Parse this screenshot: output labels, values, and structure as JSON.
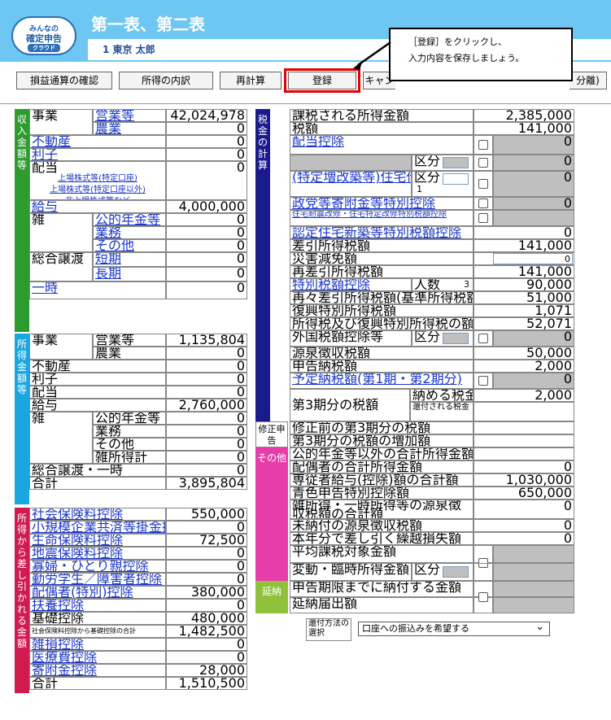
{
  "header": {
    "logo_top": "みんなの",
    "logo_mid": "確定申告",
    "logo_bot": "クラウド",
    "title": "第一表、第二表",
    "user": "1 東京 太郎"
  },
  "toolbar": {
    "btns": [
      "損益通算の確認",
      "所得の内訳",
      "再計算",
      "登録",
      "キャン",
      "分離)"
    ]
  },
  "callout": {
    "line1": "［登録］をクリックし、",
    "line2": "入力内容を保存しましょう。"
  },
  "colors": {
    "income": "#2e9b2e",
    "shotoku": "#1aa7e0",
    "kojo": "#d11a4d",
    "zeikin": "#1a1a8c",
    "sonota": "#e83caa",
    "enno": "#8fc23a"
  },
  "left": {
    "sec1": "収入金額等",
    "sec2": "所得金額等",
    "sec3": "所得から差し引かれる金額",
    "r": [
      {
        "a": "事業",
        "b": "営業等",
        "v": "42,024,978"
      },
      {
        "b": "農業",
        "v": "0"
      },
      {
        "a": "不動産",
        "v": "0"
      },
      {
        "a": "利子",
        "v": "0"
      },
      {
        "a": "配当",
        "sub1": "上場株式等(特定口座)",
        "sub2": "上場株式等(特定口座以外)",
        "sub3": "非上場株式等など",
        "v": "0"
      },
      {
        "a": "給与",
        "v": "4,000,000"
      },
      {
        "a": "雑",
        "b": "公的年金等",
        "v": "0"
      },
      {
        "b": "業務",
        "v": "0"
      },
      {
        "b": "その他",
        "v": "0"
      },
      {
        "a": "総合譲渡",
        "b": "短期",
        "v": "0"
      },
      {
        "b": "長期",
        "v": "0"
      },
      {
        "a": "一時",
        "v": "0"
      }
    ],
    "s": [
      {
        "a": "事業",
        "b": "営業等",
        "v": "1,135,804"
      },
      {
        "b": "農業",
        "v": "0"
      },
      {
        "a": "不動産",
        "v": "0"
      },
      {
        "a": "利子",
        "v": "0"
      },
      {
        "a": "配当",
        "v": "0"
      },
      {
        "a": "給与",
        "v": "2,760,000"
      },
      {
        "a": "雑",
        "b": "公的年金等",
        "v": "0"
      },
      {
        "b": "業務",
        "v": "0"
      },
      {
        "b": "その他",
        "v": "0"
      },
      {
        "b": "雑所得計",
        "v": "0"
      },
      {
        "a": "総合譲渡・一時",
        "v": "0"
      },
      {
        "a": "合計",
        "v": "3,895,804"
      }
    ],
    "k": [
      {
        "a": "社会保険料控除",
        "v": "550,000"
      },
      {
        "a": "小規模企業共済等掛金控除",
        "v": "0"
      },
      {
        "a": "生命保険料控除",
        "v": "72,500"
      },
      {
        "a": "地震保険料控除",
        "v": "0"
      },
      {
        "a": "寡婦・ひとり親控除",
        "v": "0"
      },
      {
        "a": "勤労学生／障害者控除",
        "v": "0"
      },
      {
        "a": "配偶者(特別)控除",
        "v": "380,000"
      },
      {
        "a": "扶養控除",
        "v": "0"
      },
      {
        "a": "基礎控除",
        "v": "480,000"
      },
      {
        "a": "社会保険料控除から基礎控除の合計",
        "v": "1,482,500"
      },
      {
        "a": "雑損控除",
        "v": "0"
      },
      {
        "a": "医療費控除",
        "v": "0"
      },
      {
        "a": "寄附金控除",
        "v": "28,000"
      },
      {
        "a": "合計",
        "v": "1,510,500"
      }
    ]
  },
  "right": {
    "sec_zei": "税金の計算",
    "sec_shusei": "修正申告",
    "sec_sonota": "その他",
    "sec_enno": "延納",
    "z": [
      {
        "a": "課税される所得金額",
        "v": "2,385,000"
      },
      {
        "a": "税額",
        "v": "141,000"
      },
      {
        "a": "配当控除",
        "v": "0"
      },
      {
        "a": "",
        "kubun": "区分",
        "v": "0"
      },
      {
        "a": "(特定増改築等)住宅借入金等特別控除",
        "kubun": "区分",
        "k1": "1",
        "v": "0"
      },
      {
        "a": "政党等寄附金等特別控除",
        "v": "0"
      },
      {
        "a": "住宅耐震改修・住宅特定改修特別税額控除",
        "v": ""
      },
      {
        "a": "認定住宅新築等特別税額控除",
        "v": "0"
      },
      {
        "a": "差引所得税額",
        "v": "141,000"
      },
      {
        "a": "災害減免額",
        "v": "0"
      },
      {
        "a": "再差引所得税額",
        "v": "141,000"
      },
      {
        "a": "特別税額控除",
        "ninzu": "人数",
        "n": "3",
        "v": "90,000"
      },
      {
        "a": "再々差引所得税額(基準所得税額)",
        "v": "51,000"
      },
      {
        "a": "復興特別所得税額",
        "v": "1,071"
      },
      {
        "a": "所得税及び復興特別所得税の額",
        "v": "52,071"
      },
      {
        "a": "外国税額控除等",
        "kubun": "区分",
        "v": "0"
      },
      {
        "a": "源泉徴収税額",
        "v": "50,000"
      },
      {
        "a": "申告納税額",
        "v": "2,000"
      },
      {
        "a": "予定納税額(第1期・第2期分)",
        "v": "0"
      },
      {
        "a": "第3期分の税額",
        "n1": "納める税金",
        "v1": "2,000",
        "n2": "還付される税金",
        "v2": ""
      }
    ],
    "shusei": [
      {
        "a": "修正前の第3期分の税額"
      },
      {
        "a": "第3期分の税額の増加額"
      }
    ],
    "so": [
      {
        "a": "公的年金等以外の合計所得金額",
        "v": ""
      },
      {
        "a": "配偶者の合計所得金額",
        "v": "0"
      },
      {
        "a": "専従者給与(控除)額の合計額",
        "v": "1,030,000"
      },
      {
        "a": "青色申告特別控除額",
        "v": "650,000"
      },
      {
        "a": "雑所得・一時所得等の源泉徴収税額の合計額",
        "v": "0"
      },
      {
        "a": "未納付の源泉徴収税額",
        "v": "0"
      },
      {
        "a": "本年分で差し引く繰越損失額",
        "v": "0"
      },
      {
        "a": "平均課税対象金額",
        "v": ""
      },
      {
        "a": "変動・臨時所得金額",
        "kubun": "区分",
        "v": ""
      }
    ],
    "en": [
      {
        "a": "申告期限までに納付する金額"
      },
      {
        "a": "延納届出額"
      }
    ],
    "kanpu_label": "還付方法の選択",
    "kanpu_value": "口座への振込みを希望する"
  }
}
